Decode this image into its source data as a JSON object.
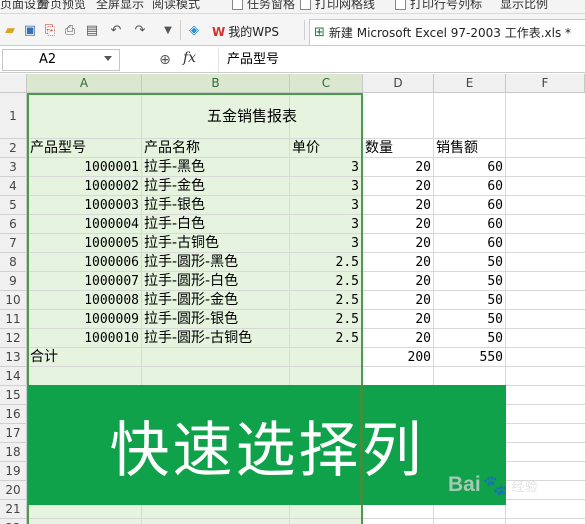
{
  "ribbon": {
    "items": [
      "页面设置",
      "分页预览",
      "全屏显示",
      "阅读模式",
      "任务窗格",
      "打印网格线",
      "打印行号列标",
      "显示比例"
    ]
  },
  "tabs": {
    "wps_label": "我的WPS",
    "doc_label": "新建 Microsoft Excel 97-2003 工作表.xls *"
  },
  "formula_bar": {
    "cell_ref": "A2",
    "fx_label": "fx",
    "content": "产品型号"
  },
  "columns": [
    "A",
    "B",
    "C",
    "D",
    "E",
    "F"
  ],
  "rows": [
    "1",
    "2",
    "3",
    "4",
    "5",
    "6",
    "7",
    "8",
    "9",
    "10",
    "11",
    "12",
    "13",
    "14",
    "15",
    "16",
    "17",
    "18",
    "19",
    "20",
    "21",
    "22"
  ],
  "sheet": {
    "title": "五金销售报表",
    "headers": {
      "model": "产品型号",
      "name": "产品名称",
      "price": "单价",
      "qty": "数量",
      "amount": "销售额"
    },
    "records": [
      {
        "model": "1000001",
        "name": "拉手-黑色",
        "price": "3",
        "qty": "20",
        "amount": "60"
      },
      {
        "model": "1000002",
        "name": "拉手-金色",
        "price": "3",
        "qty": "20",
        "amount": "60"
      },
      {
        "model": "1000003",
        "name": "拉手-银色",
        "price": "3",
        "qty": "20",
        "amount": "60"
      },
      {
        "model": "1000004",
        "name": "拉手-白色",
        "price": "3",
        "qty": "20",
        "amount": "60"
      },
      {
        "model": "1000005",
        "name": "拉手-古铜色",
        "price": "3",
        "qty": "20",
        "amount": "60"
      },
      {
        "model": "1000006",
        "name": "拉手-圆形-黑色",
        "price": "2.5",
        "qty": "20",
        "amount": "50"
      },
      {
        "model": "1000007",
        "name": "拉手-圆形-白色",
        "price": "2.5",
        "qty": "20",
        "amount": "50"
      },
      {
        "model": "1000008",
        "name": "拉手-圆形-金色",
        "price": "2.5",
        "qty": "20",
        "amount": "50"
      },
      {
        "model": "1000009",
        "name": "拉手-圆形-银色",
        "price": "2.5",
        "qty": "20",
        "amount": "50"
      },
      {
        "model": "1000010",
        "name": "拉手-圆形-古铜色",
        "price": "2.5",
        "qty": "20",
        "amount": "50"
      }
    ],
    "total": {
      "label": "合计",
      "qty": "200",
      "amount": "550"
    }
  },
  "banner": {
    "text": "快速选择列"
  },
  "watermark": {
    "brand": "Bai",
    "brand2": "经验",
    "paw": "🐾"
  },
  "colors": {
    "selection_fill": "#e6f3df",
    "selection_border": "#4b9a4d",
    "banner_bg": "#10a24a",
    "wps_red": "#d9302c"
  }
}
